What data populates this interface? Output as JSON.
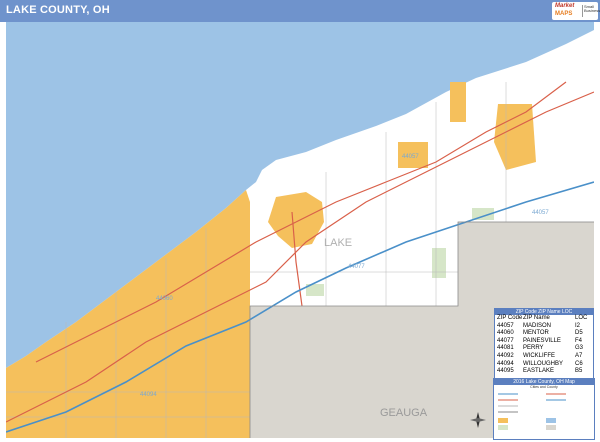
{
  "header": {
    "title": "LAKE COUNTY, OH",
    "brand_color": "#6f93cc"
  },
  "logo": {
    "line1": "Market",
    "line2": "MAPS",
    "line3": "Small Business"
  },
  "map": {
    "water_color": "#9dc3e6",
    "urban_color": "#f5c05c",
    "land_color": "#ffffff",
    "neighbor_color": "#d9d6cf",
    "park_color": "#d6e6c8",
    "county_labels": {
      "lake": "LAKE",
      "geauga": "GEAUGA"
    },
    "zip_labels": [
      "44057",
      "44077",
      "44060",
      "44057",
      "44094"
    ]
  },
  "zip_table": {
    "header": "ZIP Code  ZIP Name  LOC",
    "columns": [
      "ZIP Code",
      "ZIP Name",
      "LOC"
    ],
    "rows": [
      [
        "44057",
        "MADISON",
        "I2"
      ],
      [
        "44060",
        "MENTOR",
        "D5"
      ],
      [
        "44077",
        "PAINESVILLE",
        "F4"
      ],
      [
        "44081",
        "PERRY",
        "G3"
      ],
      [
        "44092",
        "WICKLIFFE",
        "A7"
      ],
      [
        "44094",
        "WILLOUGHBY",
        "C6"
      ],
      [
        "44095",
        "EASTLAKE",
        "B5"
      ]
    ]
  },
  "legend": {
    "title": "2016 Lake County, OH Map",
    "subtitle": "Cities and County"
  }
}
